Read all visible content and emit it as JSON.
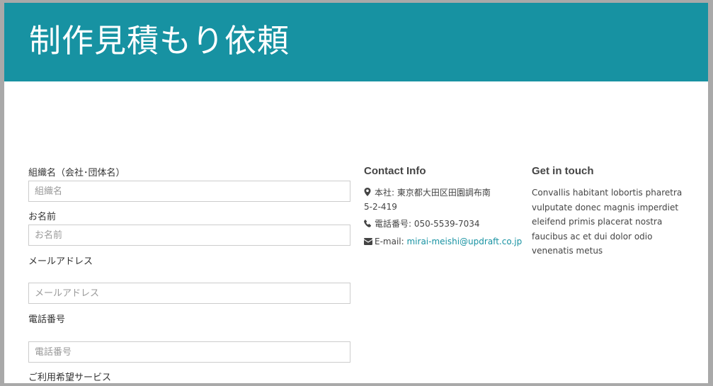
{
  "header": {
    "title": "制作見積もり依頼",
    "background_color": "#1792a2"
  },
  "form": {
    "fields": [
      {
        "label": "組織名（会社･団体名）",
        "placeholder": "組織名"
      },
      {
        "label": "お名前",
        "placeholder": "お名前"
      },
      {
        "label": "メールアドレス",
        "placeholder": "メールアドレス"
      },
      {
        "label": "電話番号",
        "placeholder": "電話番号"
      },
      {
        "label": "ご利用希望サービス"
      }
    ]
  },
  "contact_info": {
    "heading": "Contact Info",
    "address": "本社: 東京都大田区田園調布南",
    "address_line2": "5-2-419",
    "phone": "電話番号: 050-5539-7034",
    "email_label": "E-mail: ",
    "email": "mirai-meishi@updraft.co.jp",
    "icons": [
      "map-marker-icon",
      "phone-icon",
      "envelope-icon"
    ]
  },
  "get_in_touch": {
    "heading": "Get in touch",
    "text": "Convallis habitant lobortis pharetra vulputate donec magnis imperdiet eleifend primis placerat nostra faucibus ac et dui dolor odio venenatis metus"
  },
  "colors": {
    "accent": "#1792a2",
    "frame_border": "#a9a9a9"
  }
}
